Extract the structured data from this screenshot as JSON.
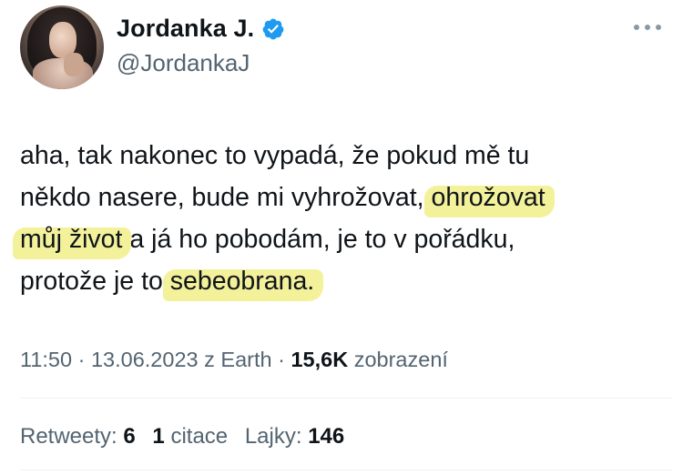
{
  "user": {
    "display_name": "Jordanka J.",
    "handle": "@JordankaJ"
  },
  "icons": {
    "verified": "verified-badge-icon",
    "more": "more-options-icon"
  },
  "colors": {
    "verified_blue": "#1d9bf0",
    "highlight_yellow": "#f2ef8a",
    "secondary_text": "#536471"
  },
  "tweet": {
    "lines": [
      [
        "aha, tak nakonec to vypadá, že pokud mě tu"
      ],
      [
        "někdo nasere, bude mi vyhrožovat, ",
        "ohrožovat"
      ],
      [
        "můj život",
        " a já ho pobodám, je to v pořádku,"
      ],
      [
        "protože je to ",
        "sebeobrana."
      ]
    ]
  },
  "meta": {
    "time": "11:50",
    "date": "13.06.2023",
    "source": "z Earth",
    "views_count": "15,6K",
    "views_label": "zobrazení"
  },
  "stats": {
    "retweets_label": "Retweety:",
    "retweets_count": "6",
    "quotes_count": "1",
    "quotes_label": "citace",
    "likes_label": "Lajky:",
    "likes_count": "146"
  }
}
